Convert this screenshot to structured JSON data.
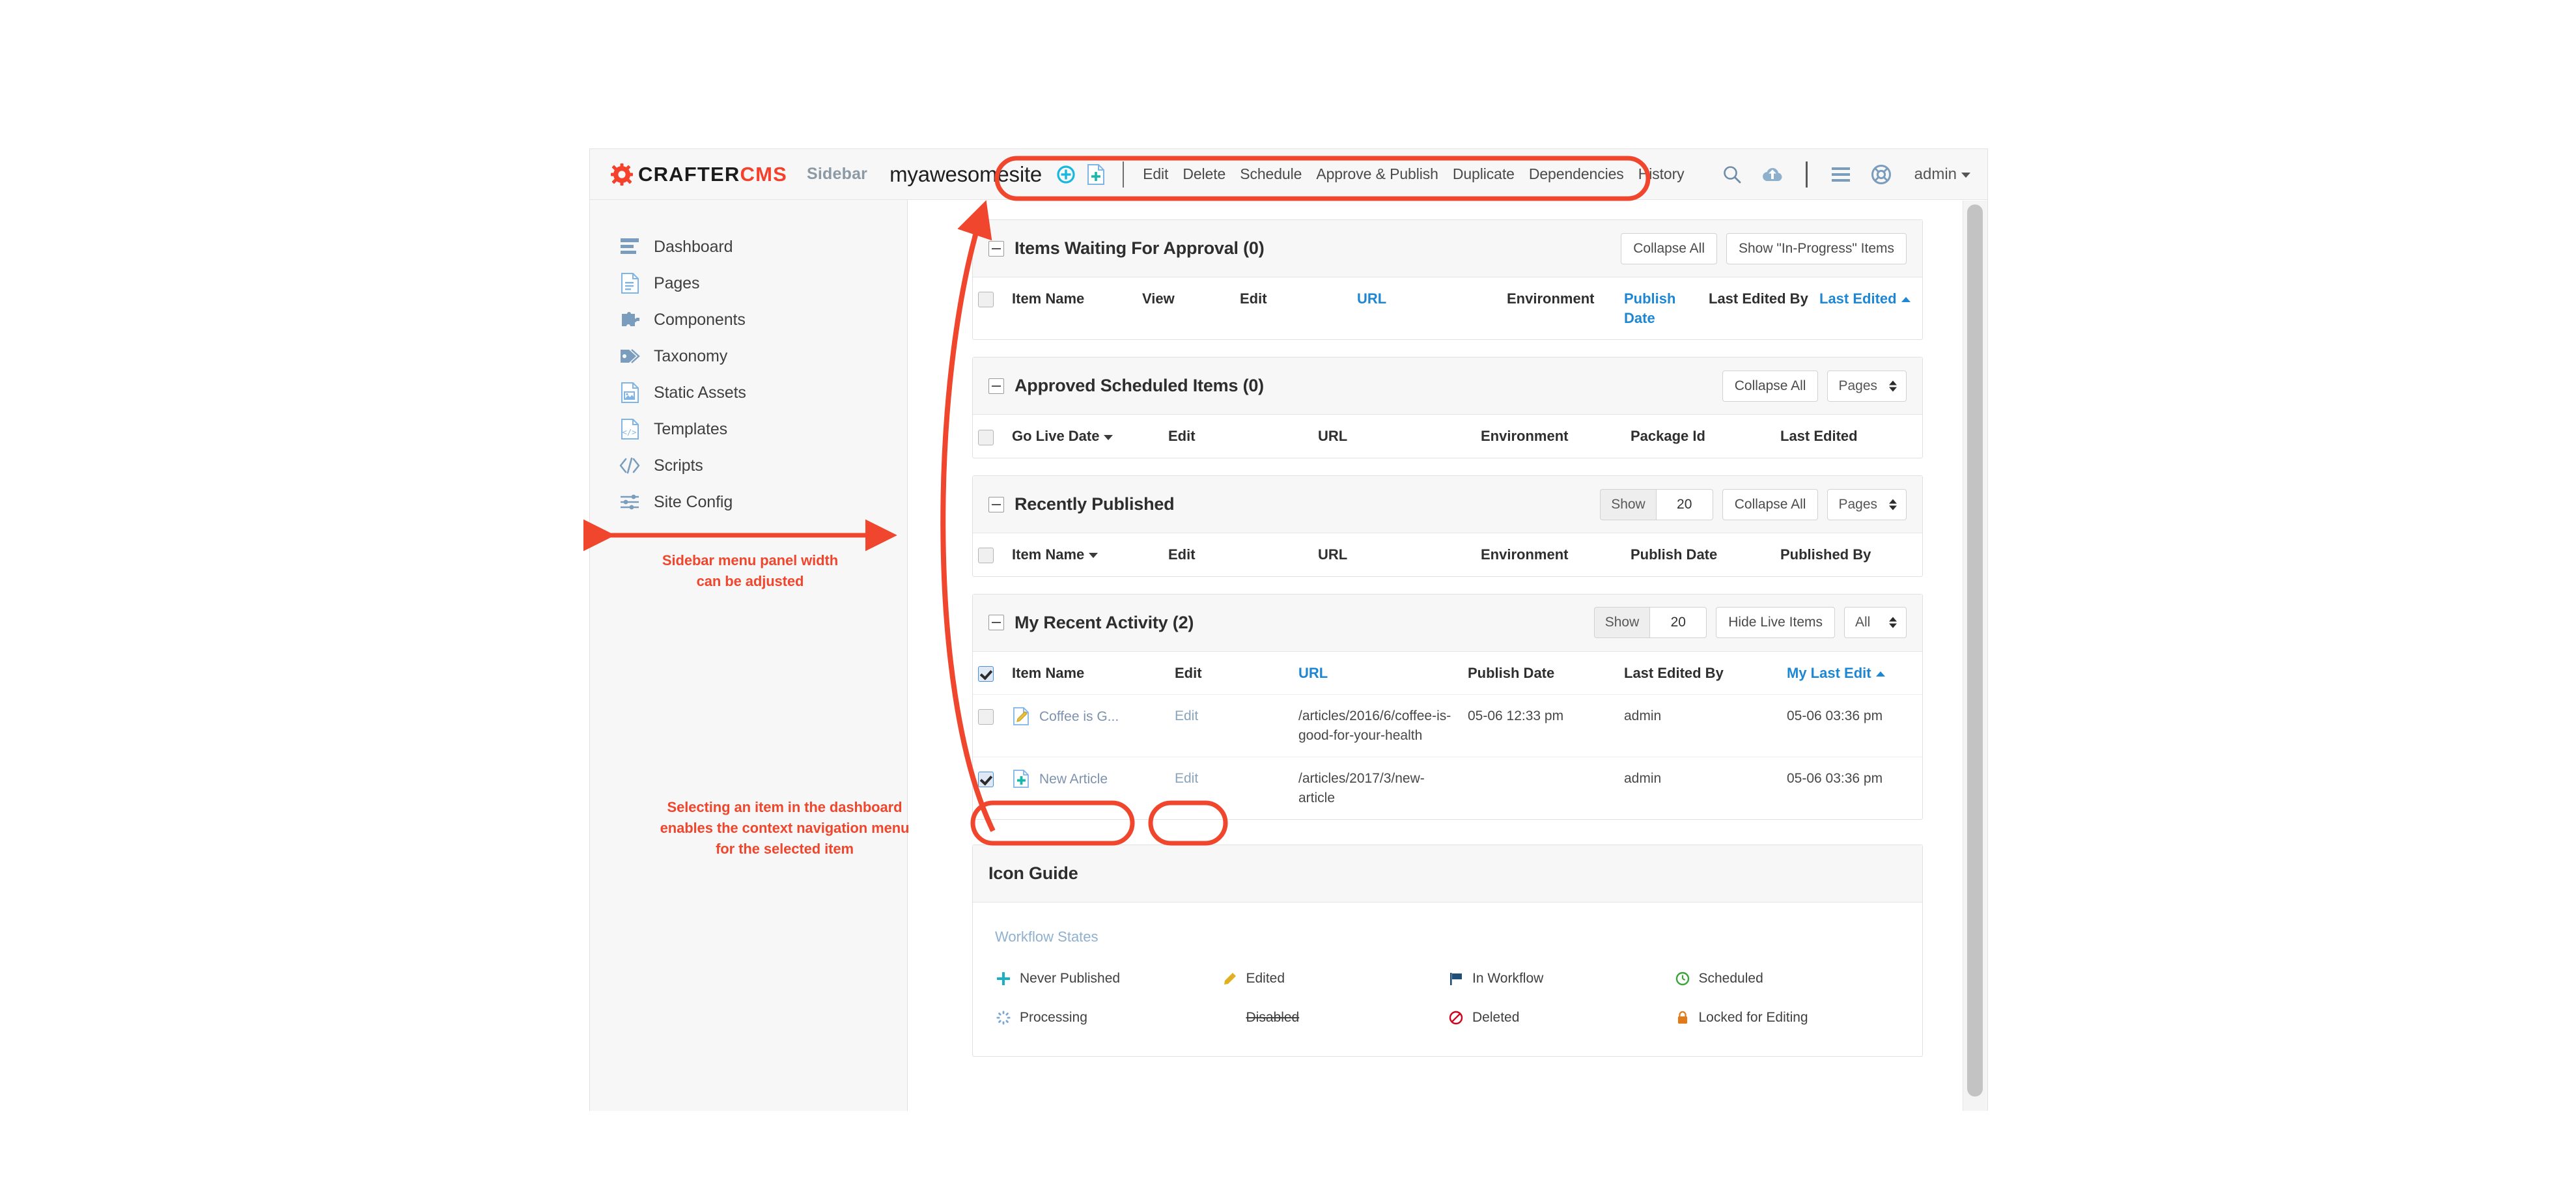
{
  "header": {
    "brand_primary": "CRAFTER",
    "brand_secondary": "CMS",
    "sidebar_toggle": "Sidebar",
    "site_name": "myawesomesite",
    "user": "admin",
    "accent_red": "#f5402c",
    "link_blue": "#1e87d4",
    "context_menu": [
      "Edit",
      "Delete",
      "Schedule",
      "Approve & Publish",
      "Duplicate",
      "Dependencies",
      "History"
    ],
    "right_icons": [
      "search-icon",
      "cloud-upload-icon",
      "hamburger-menu-icon",
      "help-lifebuoy-icon"
    ],
    "left_icons": [
      "target-plus-icon",
      "new-content-page-icon"
    ]
  },
  "sidebar": {
    "items": [
      {
        "label": "Dashboard",
        "icon": "dashboard-icon"
      },
      {
        "label": "Pages",
        "icon": "page-document-icon"
      },
      {
        "label": "Components",
        "icon": "puzzle-piece-icon"
      },
      {
        "label": "Taxonomy",
        "icon": "tag-icon"
      },
      {
        "label": "Static Assets",
        "icon": "image-document-icon"
      },
      {
        "label": "Templates",
        "icon": "code-document-icon"
      },
      {
        "label": "Scripts",
        "icon": "code-brackets-icon"
      },
      {
        "label": "Site Config",
        "icon": "sliders-icon"
      }
    ]
  },
  "annotations": {
    "sidebar_width": "Sidebar menu panel width\ncan be adjusted",
    "sidebar_width_line1": "Sidebar menu panel width",
    "sidebar_width_line2": "can be adjusted",
    "context_nav_line1": "Selecting an item in the dashboard",
    "context_nav_line2": "enables the context navigation menu",
    "context_nav_line3": "for the selected item",
    "color": "#f0462d"
  },
  "panels": [
    {
      "title": "Items Waiting For Approval (0)",
      "buttons": [
        "Collapse All",
        "Show \"In-Progress\" Items"
      ],
      "columns": [
        {
          "label": "Item Name",
          "link": false
        },
        {
          "label": "View",
          "link": false
        },
        {
          "label": "Edit",
          "link": false
        },
        {
          "label": "URL",
          "link": true
        },
        {
          "label": "Environment",
          "link": false
        },
        {
          "label": "Publish Date",
          "link": true
        },
        {
          "label": "Last Edited By",
          "link": false
        },
        {
          "label": "Last Edited",
          "link": true,
          "sort": "asc"
        }
      ],
      "rows": []
    },
    {
      "title": "Approved Scheduled Items (0)",
      "buttons": [
        "Collapse All"
      ],
      "select": "Pages",
      "columns": [
        {
          "label": "Go Live Date",
          "link": false,
          "sort": "desc"
        },
        {
          "label": "Edit",
          "link": false
        },
        {
          "label": "URL",
          "link": false
        },
        {
          "label": "Environment",
          "link": false
        },
        {
          "label": "Package Id",
          "link": false
        },
        {
          "label": "Last Edited",
          "link": false
        }
      ],
      "rows": []
    },
    {
      "title": "Recently Published",
      "show_label": "Show",
      "show_value": "20",
      "buttons": [
        "Collapse All"
      ],
      "select": "Pages",
      "columns": [
        {
          "label": "Item Name",
          "link": false,
          "sort": "desc"
        },
        {
          "label": "Edit",
          "link": false
        },
        {
          "label": "URL",
          "link": false
        },
        {
          "label": "Environment",
          "link": false
        },
        {
          "label": "Publish Date",
          "link": false
        },
        {
          "label": "Published By",
          "link": false
        }
      ],
      "rows": []
    },
    {
      "title": "My Recent Activity (2)",
      "show_label": "Show",
      "show_value": "20",
      "buttons": [
        "Hide Live Items"
      ],
      "select": "All",
      "header_checked": true,
      "columns": [
        {
          "label": "Item Name",
          "link": false
        },
        {
          "label": "Edit",
          "link": false
        },
        {
          "label": "URL",
          "link": true
        },
        {
          "label": "Publish Date",
          "link": false
        },
        {
          "label": "Last Edited By",
          "link": false
        },
        {
          "label": "My Last Edit",
          "link": true,
          "sort": "asc"
        }
      ],
      "rows": [
        {
          "checked": false,
          "icon": "edited-pencil-icon",
          "name": "Coffee is G...",
          "edit": "Edit",
          "url": "/articles/2016/6/coffee-is-good-for-your-health",
          "publish_date": "05-06 12:33 pm",
          "last_edited_by": "admin",
          "my_last_edit": "05-06 03:36 pm"
        },
        {
          "checked": true,
          "icon": "never-published-plus-icon",
          "name": "New Article",
          "edit": "Edit",
          "url": "/articles/2017/3/new-article",
          "publish_date": "",
          "last_edited_by": "admin",
          "my_last_edit": "05-06 03:36 pm"
        }
      ]
    }
  ],
  "icon_guide": {
    "title": "Icon Guide",
    "section": "Workflow States",
    "entries": [
      {
        "label": "Never Published",
        "icon": "plus-icon",
        "color": "#19b0c4",
        "strike": false
      },
      {
        "label": "Edited",
        "icon": "pencil-icon",
        "color": "#e0b020",
        "strike": false
      },
      {
        "label": "In Workflow",
        "icon": "flag-icon",
        "color": "#1f4e79",
        "strike": false
      },
      {
        "label": "Scheduled",
        "icon": "clock-icon",
        "color": "#3aa33a",
        "strike": false
      },
      {
        "label": "Processing",
        "icon": "spinner-icon",
        "color": "#7aa7d4",
        "strike": false
      },
      {
        "label": "Disabled",
        "icon": "none",
        "color": "#3f3f3f",
        "strike": true
      },
      {
        "label": "Deleted",
        "icon": "no-entry-icon",
        "color": "#d0021b",
        "strike": false
      },
      {
        "label": "Locked for Editing",
        "icon": "lock-icon",
        "color": "#e07b18",
        "strike": false
      }
    ]
  }
}
